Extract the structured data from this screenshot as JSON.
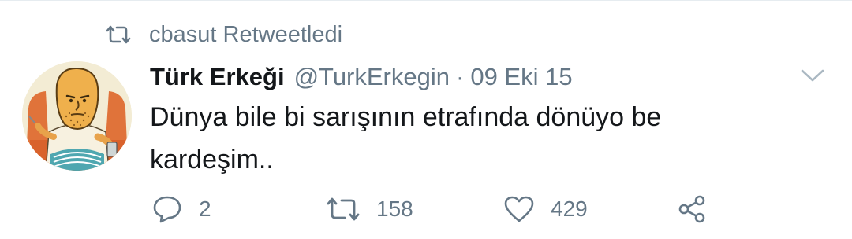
{
  "retweet_context": {
    "text": "cbasut Retweetledi",
    "icon": "retweet-icon"
  },
  "tweet": {
    "display_name": "Türk Erkeği",
    "handle": "@TurkErkegin",
    "separator": "·",
    "date": "09 Eki 15",
    "text": "Dünya bile bi sarışının etrafında dönüyo be kardeşim..",
    "avatar_icon": "cartoon-man-avatar"
  },
  "actions": {
    "reply": {
      "icon": "reply-icon",
      "count": "2"
    },
    "retweet": {
      "icon": "retweet-icon",
      "count": "158"
    },
    "like": {
      "icon": "heart-icon",
      "count": "429"
    },
    "share": {
      "icon": "share-icon"
    }
  },
  "colors": {
    "text_primary": "#14171a",
    "text_secondary": "#657786",
    "divider": "#e6ecf0"
  }
}
